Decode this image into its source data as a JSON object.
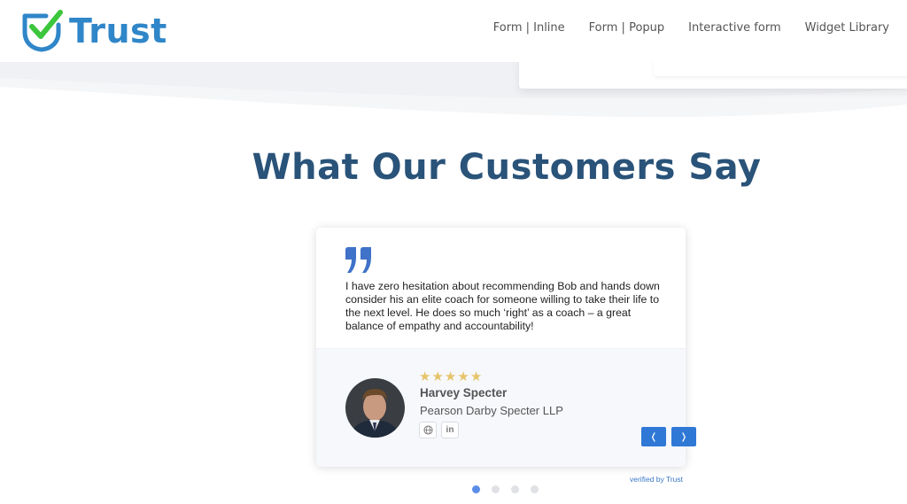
{
  "brand": {
    "name": "Trust",
    "color": "#2f86c8",
    "check_color": "#3cc63c"
  },
  "nav": {
    "links": [
      {
        "label": "Form | Inline"
      },
      {
        "label": "Form | Popup"
      },
      {
        "label": "Interactive form"
      },
      {
        "label": "Widget Library"
      }
    ]
  },
  "section": {
    "title": "What Our Customers Say",
    "title_color": "#2a5379"
  },
  "testimonial": {
    "quote_icon": "quote-mark-icon",
    "quote": "I have zero hesitation about recommending Bob and hands down consider his an elite coach for someone willing to take their life to the next level. He does so much ‘right’ as a coach – a great balance of empathy and accountability!",
    "rating": 5,
    "rating_max": 5,
    "name": "Harvey Specter",
    "company": "Pearson Darby Specter LLP",
    "socials": [
      {
        "icon": "globe-icon"
      },
      {
        "icon": "linkedin-icon",
        "label": "in"
      }
    ]
  },
  "carousel": {
    "prev_label": "❬",
    "next_label": "❭",
    "accent": "#2f78d6",
    "slides": 4,
    "active_slide": 1
  },
  "footer": {
    "verified": "verified by Trust"
  }
}
